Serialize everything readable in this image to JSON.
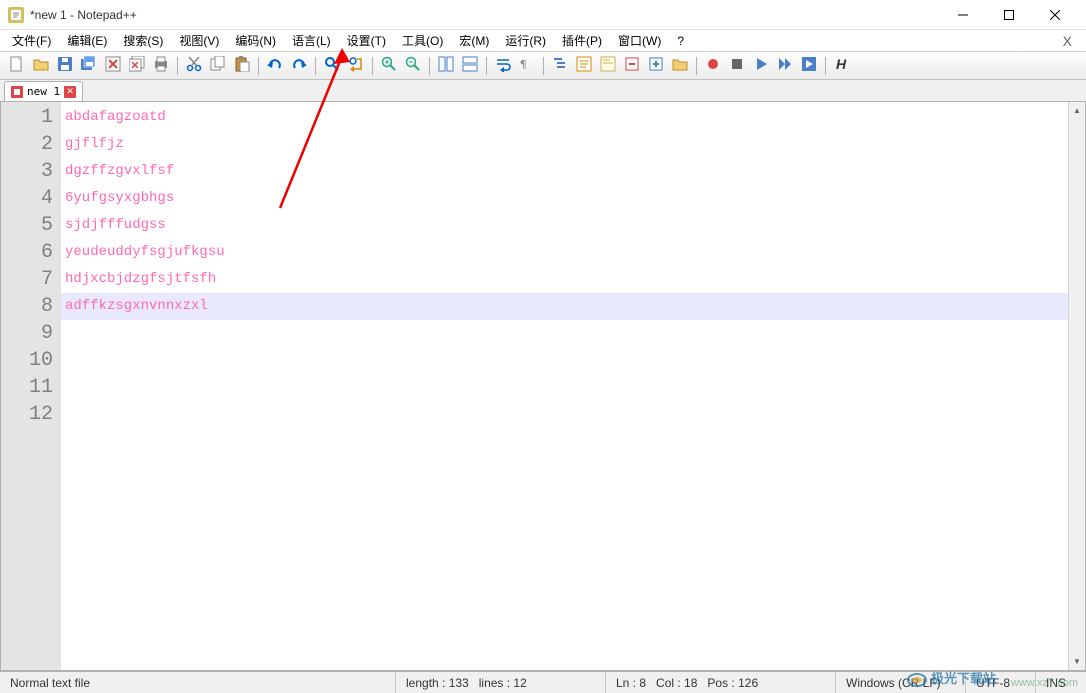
{
  "window": {
    "title": "*new 1 - Notepad++"
  },
  "menubar": {
    "items": [
      "文件(F)",
      "编辑(E)",
      "搜索(S)",
      "视图(V)",
      "编码(N)",
      "语言(L)",
      "设置(T)",
      "工具(O)",
      "宏(M)",
      "运行(R)",
      "插件(P)",
      "窗口(W)",
      "?"
    ]
  },
  "toolbar_icons": [
    "new-file",
    "open-file",
    "save",
    "save-all",
    "close",
    "close-all",
    "print",
    "sep",
    "cut",
    "copy",
    "paste",
    "sep",
    "undo",
    "redo",
    "sep",
    "find",
    "replace",
    "sep",
    "zoom-in",
    "zoom-out",
    "sep",
    "sync-v",
    "sync-h",
    "sep",
    "word-wrap",
    "show-all",
    "sep",
    "indent-guide",
    "function-list",
    "doc-map",
    "fold-all",
    "unfold-all",
    "folder",
    "sep",
    "macro-record",
    "macro-stop",
    "macro-play",
    "macro-run-multi",
    "macro-save",
    "sep",
    "monitor-h"
  ],
  "tabs": [
    {
      "label": "new 1",
      "dirty": true
    }
  ],
  "editor": {
    "gutter": [
      "1",
      "2",
      "3",
      "4",
      "5",
      "6",
      "7",
      "8",
      "9",
      "10",
      "11",
      "12"
    ],
    "lines": [
      "abdafagzoatd",
      "gjflfjz",
      "dgzffzgvxlfsf",
      "6yufgsyxgbhgs",
      "sjdjfffudgss",
      "yeudeuddyfsgjufkgsu",
      "hdjxcbjdzgfsjtfsfh",
      "adffkzsgxnvnnxzxl",
      "",
      "",
      "",
      ""
    ],
    "highlighted_line_index": 7
  },
  "statusbar": {
    "file_type": "Normal text file",
    "length": "length : 133",
    "lines": "lines : 12",
    "ln": "Ln : 8",
    "col": "Col : 18",
    "pos": "Pos : 126",
    "eol": "Windows (CR LF)",
    "encoding": "UTF-8",
    "mode": "INS"
  },
  "watermark": {
    "logo_text": "极光下载站",
    "url": "www.xz7.com"
  }
}
